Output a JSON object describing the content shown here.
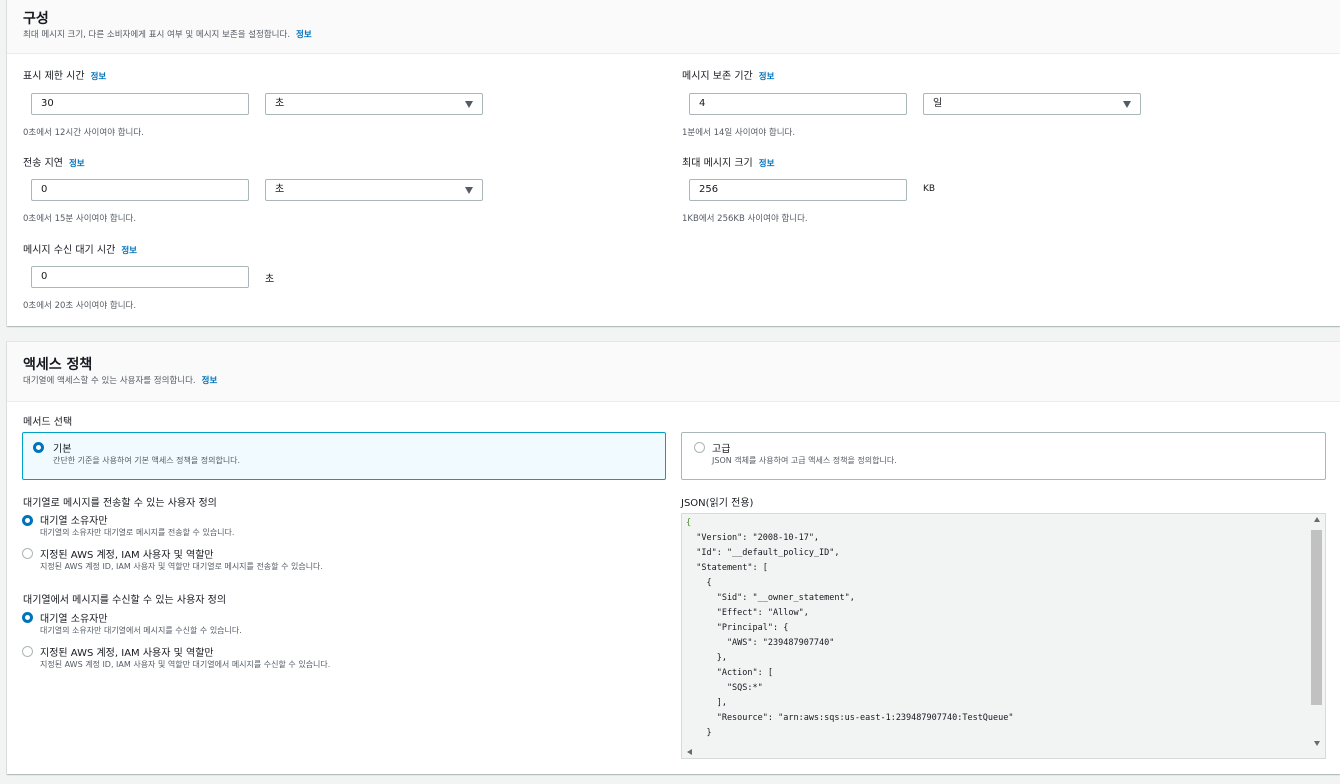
{
  "configuration": {
    "title": "구성",
    "description": "최대 메시지 크기, 다른 소비자에게 표시 여부 및 메시지 보존을 설정합니다.",
    "info": "정보",
    "visibility_timeout": {
      "label": "표시 제한 시간",
      "info": "정보",
      "value": "30",
      "unit": "초",
      "hint": "0초에서 12시간 사이여야 합니다."
    },
    "delivery_delay": {
      "label": "전송 지연",
      "info": "정보",
      "value": "0",
      "unit": "초",
      "hint": "0초에서 15분 사이여야 합니다."
    },
    "receive_wait": {
      "label": "메시지 수신 대기 시간",
      "info": "정보",
      "value": "0",
      "unit": "초",
      "hint": "0초에서 20초 사이여야 합니다."
    },
    "retention": {
      "label": "메시지 보존 기간",
      "info": "정보",
      "value": "4",
      "unit": "일",
      "hint": "1분에서 14일 사이여야 합니다."
    },
    "max_size": {
      "label": "최대 메시지 크기",
      "info": "정보",
      "value": "256",
      "unit": "KB",
      "hint": "1KB에서 256KB 사이여야 합니다."
    }
  },
  "access_policy": {
    "title": "액세스 정책",
    "description": "대기열에 액세스할 수 있는 사용자를 정의합니다.",
    "info": "정보",
    "method_label": "메서드 선택",
    "methods": [
      {
        "title": "기본",
        "desc": "간단한 기준을 사용하여 기본 액세스 정책을 정의합니다.",
        "selected": true
      },
      {
        "title": "고급",
        "desc": "JSON 객체를 사용하여 고급 액세스 정책을 정의합니다.",
        "selected": false
      }
    ],
    "send_group": {
      "label": "대기열로 메시지를 전송할 수 있는 사용자 정의",
      "options": [
        {
          "title": "대기열 소유자만",
          "desc": "대기열의 소유자만 대기열로 메시지를 전송할 수 있습니다.",
          "selected": true
        },
        {
          "title": "지정된 AWS 계정, IAM 사용자 및 역할만",
          "desc": "지정된 AWS 계정 ID, IAM 사용자 및 역할만 대기열로 메시지를 전송할 수 있습니다.",
          "selected": false
        }
      ]
    },
    "receive_group": {
      "label": "대기열에서 메시지를 수신할 수 있는 사용자 정의",
      "options": [
        {
          "title": "대기열 소유자만",
          "desc": "대기열의 소유자만 대기열에서 메시지를 수신할 수 있습니다.",
          "selected": true
        },
        {
          "title": "지정된 AWS 계정, IAM 사용자 및 역할만",
          "desc": "지정된 AWS 계정 ID, IAM 사용자 및 역할만 대기열에서 메시지를 수신할 수 있습니다.",
          "selected": false
        }
      ]
    },
    "json_label": "JSON(읽기 전용)",
    "json_lines": [
      "{",
      "  \"Version\": \"2008-10-17\",",
      "  \"Id\": \"__default_policy_ID\",",
      "  \"Statement\": [",
      "    {",
      "      \"Sid\": \"__owner_statement\",",
      "      \"Effect\": \"Allow\",",
      "      \"Principal\": {",
      "        \"AWS\": \"239487907740\"",
      "      },",
      "      \"Action\": [",
      "        \"SQS:*\"",
      "      ],",
      "      \"Resource\": \"arn:aws:sqs:us-east-1:239487907740:TestQueue\"",
      "    }"
    ]
  }
}
